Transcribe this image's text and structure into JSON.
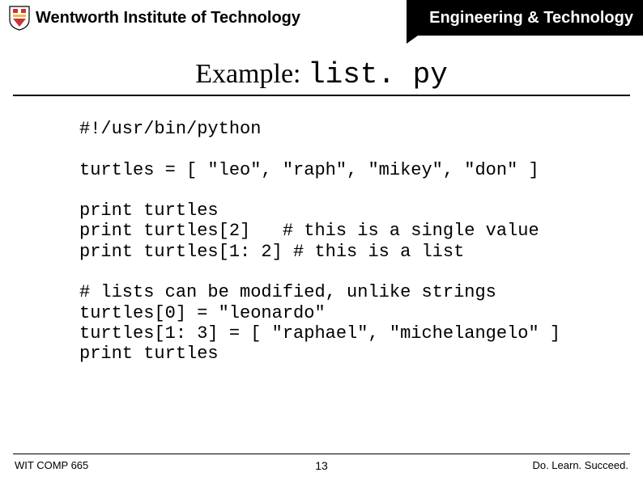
{
  "header": {
    "institution": "Wentworth Institute of Technology",
    "department": "Engineering & Technology"
  },
  "title": {
    "prefix": "Example: ",
    "filename": "list. py"
  },
  "code": "#!/usr/bin/python\n\nturtles = [ \"leo\", \"raph\", \"mikey\", \"don\" ]\n\nprint turtles\nprint turtles[2]   # this is a single value\nprint turtles[1: 2] # this is a list\n\n# lists can be modified, unlike strings\nturtles[0] = \"leonardo\"\nturtles[1: 3] = [ \"raphael\", \"michelangelo\" ]\nprint turtles",
  "footer": {
    "course": "WIT COMP 665",
    "page": "13",
    "motto": "Do. Learn. Succeed."
  }
}
